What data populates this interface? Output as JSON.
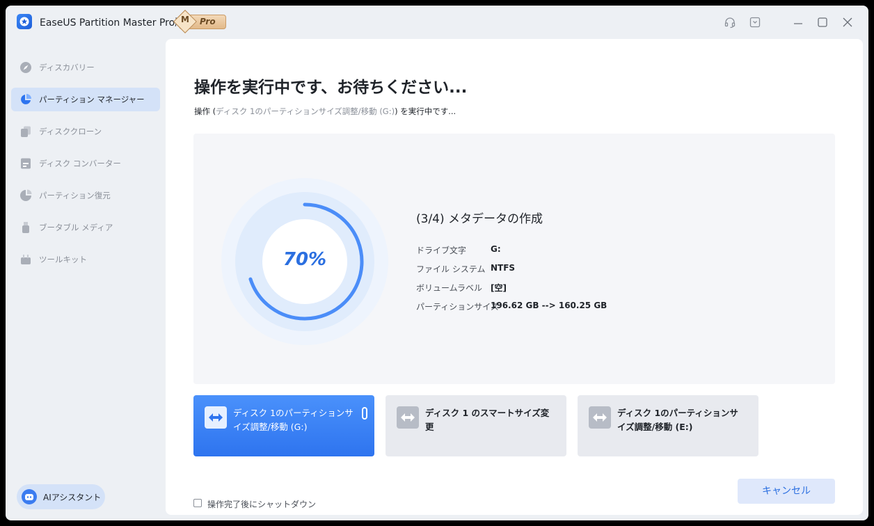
{
  "titlebar": {
    "app_title": "EaseUS Partition Master Pro版",
    "badge_letter": "M",
    "badge_text": "Pro"
  },
  "sidebar": {
    "items": [
      {
        "label": "ディスカバリー",
        "icon": "compass-icon"
      },
      {
        "label": "パーティション マネージャー",
        "icon": "pie-chart-icon"
      },
      {
        "label": "ディスククローン",
        "icon": "clone-icon"
      },
      {
        "label": "ディスク コンバーター",
        "icon": "convert-icon"
      },
      {
        "label": "パーティション復元",
        "icon": "recovery-icon"
      },
      {
        "label": "ブータブル メディア",
        "icon": "usb-icon"
      },
      {
        "label": "ツールキット",
        "icon": "toolbox-icon"
      }
    ],
    "active_index": 1,
    "ai_assistant": "AIアシスタント"
  },
  "main": {
    "title": "操作を実行中です、お待ちください...",
    "subtitle_prefix": "操作 (",
    "subtitle_op": "ディスク 1のパーティションサイズ調整/移動 (G:)",
    "subtitle_suffix": ") を実行中です...",
    "progress": {
      "percent_label": "70%",
      "percent": 70,
      "step_title": "(3/4) メタデータの作成",
      "details": [
        {
          "label": "ドライブ文字",
          "value": "G:"
        },
        {
          "label": "ファイル システム",
          "value": "NTFS"
        },
        {
          "label": "ボリュームラベル",
          "value": "[空]"
        },
        {
          "label": "パーティションサイズ",
          "value": "196.62 GB --> 160.25 GB"
        }
      ]
    },
    "tasks": [
      {
        "label": "ディスク 1のパーティションサイズ調整/移動 (G:)",
        "active": true
      },
      {
        "label": "ディスク 1 のスマートサイズ変更",
        "active": false
      },
      {
        "label": "ディスク 1のパーティションサイズ調整/移動 (E:)",
        "active": false
      }
    ],
    "shutdown_label": "操作完了後にシャットダウン",
    "cancel_label": "キャンセル"
  },
  "colors": {
    "accent": "#2e74ef",
    "ring_track": "#dcebfd",
    "ring_progress": "#4b8df8"
  }
}
